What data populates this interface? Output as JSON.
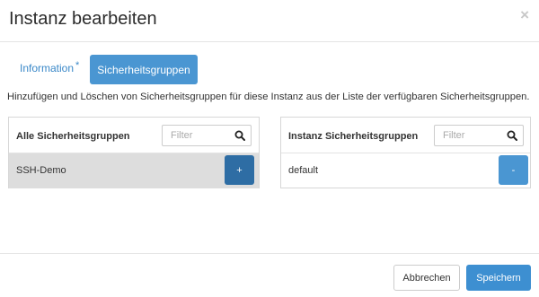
{
  "modal": {
    "title": "Instanz bearbeiten",
    "close_glyph": "×"
  },
  "tabs": [
    {
      "label": "Information",
      "required_marker": "*",
      "active": false
    },
    {
      "label": "Sicherheitsgruppen",
      "active": true
    }
  ],
  "help_text": "Hinzufügen und Löschen von Sicherheitsgruppen für diese Instanz aus der Liste der verfügbaren Sicherheitsgruppen.",
  "available": {
    "title": "Alle Sicherheitsgruppen",
    "filter_placeholder": "Filter",
    "items": [
      {
        "name": "SSH-Demo",
        "action": "+"
      }
    ]
  },
  "selected": {
    "title": "Instanz Sicherheitsgruppen",
    "filter_placeholder": "Filter",
    "items": [
      {
        "name": "default",
        "action": "-"
      }
    ]
  },
  "footer": {
    "cancel_label": "Abbrechen",
    "save_label": "Speichern"
  },
  "colors": {
    "primary": "#4a96d2",
    "primary_dark": "#2e6da4",
    "link": "#3a88c8",
    "row_highlight": "#dddddd"
  },
  "icons": {
    "close": "close-icon",
    "search": "search-icon"
  }
}
